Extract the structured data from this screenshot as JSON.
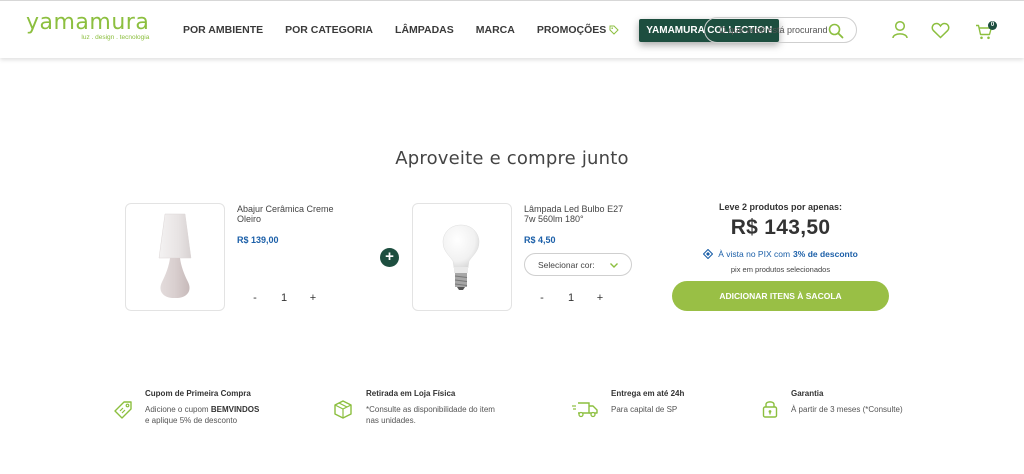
{
  "header": {
    "logo_word": "yamamura",
    "logo_tagline": "luz . design . tecnologia",
    "nav": [
      "POR AMBIENTE",
      "POR CATEGORIA",
      "LÂMPADAS",
      "MARCA",
      "PROMOÇÕES"
    ],
    "collection_label": "YAMAMURA COLLECTION",
    "search_placeholder": "O que você está procurando?",
    "cart_count": "0"
  },
  "section": {
    "title": "Aproveite e compre junto"
  },
  "products": [
    {
      "name": "Abajur Cerâmica Creme Oleiro",
      "price": "R$ 139,00",
      "qty": "1",
      "minus": "-",
      "plus": "+"
    },
    {
      "name": "Lâmpada Led Bulbo E27 7w 560lm 180°",
      "price": "R$ 4,50",
      "qty": "1",
      "minus": "-",
      "plus": "+",
      "select_label": "Selecionar cor:"
    }
  ],
  "combo_plus": "+",
  "summary": {
    "heading": "Leve 2 produtos por apenas:",
    "total": "R$ 143,50",
    "pix_text": "À vista no PIX com",
    "pix_discount": "3% de desconto",
    "pix_sub": "pix em produtos selecionados",
    "button": "ADICIONAR ITENS À SACOLA"
  },
  "benefits": [
    {
      "title": "Cupom de Primeira Compra",
      "text_pre": "Adicione o cupom",
      "text_bold": "BEMVINDOS",
      "text_post": "e aplique 5% de desconto"
    },
    {
      "title": "Retirada em Loja Física",
      "text": "*Consulte as disponibilidade do item nas unidades."
    },
    {
      "title": "Entrega em até 24h",
      "text": "Para capital de SP"
    },
    {
      "title": "Garantia",
      "text": "À partir de 3 meses (*Consulte)"
    }
  ],
  "colors": {
    "brand_green": "#8cbf3f",
    "dark_green": "#1d4e3f",
    "button_green": "#99bf45",
    "price_blue": "#1b5fa8"
  },
  "icons": [
    "tag-icon",
    "search-icon",
    "user-icon",
    "heart-icon",
    "cart-icon",
    "plus-circle-icon",
    "chevron-down-icon",
    "pix-icon",
    "coupon-icon",
    "box-icon",
    "truck-icon",
    "lock-icon"
  ]
}
